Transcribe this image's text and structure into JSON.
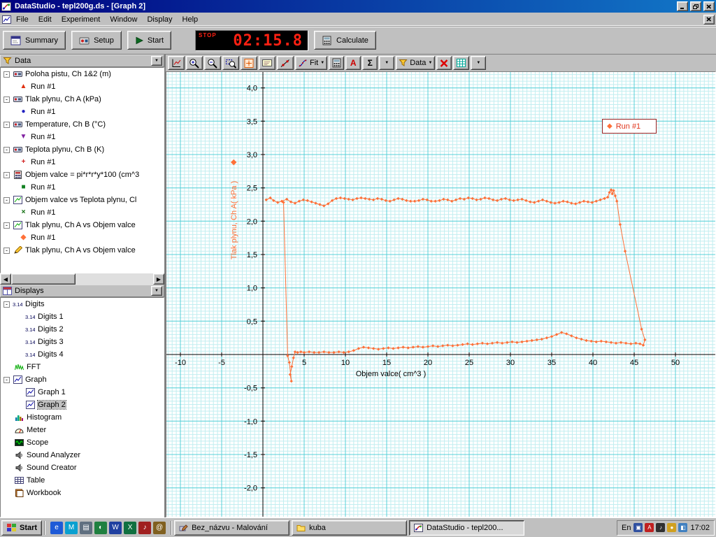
{
  "window": {
    "title": "DataStudio - tepl200g.ds - [Graph 2]",
    "menus": [
      "File",
      "Edit",
      "Experiment",
      "Window",
      "Display",
      "Help"
    ]
  },
  "toolbar": {
    "summary_label": "Summary",
    "setup_label": "Setup",
    "start_label": "Start",
    "timer_mode": "STOP",
    "timer_value": "02:15.8",
    "calculate_label": "Calculate"
  },
  "graph_toolbar": {
    "fit_label": "Fit",
    "text_tool_label": "A",
    "sigma_label": "Σ",
    "data_label": "Data"
  },
  "data_panel": {
    "title": "Data",
    "items": [
      {
        "label": "Poloha pistu, Ch 1&2 (m)",
        "icon": "sensor-icon",
        "runs": [
          {
            "label": "Run #1",
            "shape": "triangle-up",
            "color": "#e03010"
          }
        ]
      },
      {
        "label": "Tlak plynu, Ch A (kPa)",
        "icon": "sensor-icon",
        "runs": [
          {
            "label": "Run #1",
            "shape": "circle",
            "color": "#2020c0"
          }
        ]
      },
      {
        "label": "Temperature, Ch B (°C)",
        "icon": "sensor-icon",
        "runs": [
          {
            "label": "Run #1",
            "shape": "triangle-down",
            "color": "#8020a0"
          }
        ]
      },
      {
        "label": "Teplota plynu, Ch B (K)",
        "icon": "sensor-icon",
        "runs": [
          {
            "label": "Run #1",
            "shape": "plus",
            "color": "#d02020"
          }
        ]
      },
      {
        "label": "Objem valce = pi*r*r*y*100 (cm^3",
        "icon": "calculator-icon",
        "runs": [
          {
            "label": "Run #1",
            "shape": "square",
            "color": "#108020"
          }
        ]
      },
      {
        "label": "Objem valce vs Teplota plynu, Cl",
        "icon": "xy-icon",
        "runs": [
          {
            "label": "Run #1",
            "shape": "cross",
            "color": "#0a6a0a"
          }
        ]
      },
      {
        "label": "Tlak plynu, Ch A vs Objem valce",
        "icon": "xy-icon",
        "runs": [
          {
            "label": "Run #1",
            "shape": "diamond",
            "color": "#ff7038"
          }
        ]
      },
      {
        "label": "Tlak plynu, Ch A vs Objem valce",
        "icon": "pencil-icon",
        "runs": []
      }
    ]
  },
  "displays_panel": {
    "title": "Displays",
    "items": [
      {
        "label": "Digits",
        "icon": "digits-icon",
        "level": 0,
        "expand": true
      },
      {
        "label": "Digits 1",
        "icon": "digits-icon",
        "level": 1
      },
      {
        "label": "Digits 2",
        "icon": "digits-icon",
        "level": 1
      },
      {
        "label": "Digits 3",
        "icon": "digits-icon",
        "level": 1
      },
      {
        "label": "Digits 4",
        "icon": "digits-icon",
        "level": 1
      },
      {
        "label": "FFT",
        "icon": "fft-icon",
        "level": 0
      },
      {
        "label": "Graph",
        "icon": "graph-icon",
        "level": 0,
        "expand": true
      },
      {
        "label": "Graph 1",
        "icon": "graph-icon",
        "level": 1
      },
      {
        "label": "Graph 2",
        "icon": "graph-icon",
        "level": 1,
        "selected": true
      },
      {
        "label": "Histogram",
        "icon": "histogram-icon",
        "level": 0
      },
      {
        "label": "Meter",
        "icon": "meter-icon",
        "level": 0
      },
      {
        "label": "Scope",
        "icon": "scope-icon",
        "level": 0
      },
      {
        "label": "Sound Analyzer",
        "icon": "speaker-icon",
        "level": 0
      },
      {
        "label": "Sound Creator",
        "icon": "speaker-icon",
        "level": 0
      },
      {
        "label": "Table",
        "icon": "table-icon",
        "level": 0
      },
      {
        "label": "Workbook",
        "icon": "workbook-icon",
        "level": 0
      }
    ]
  },
  "graph": {
    "x_title": "Objem valce( cm^3 )",
    "y_title": "Tlak plynu, Ch A( kPa )",
    "legend_label": "Run #1",
    "x_ticks": [
      {
        "v": -10,
        "t": "-10"
      },
      {
        "v": -5,
        "t": "-5"
      },
      {
        "v": 5,
        "t": "5"
      },
      {
        "v": 10,
        "t": "10"
      },
      {
        "v": 15,
        "t": "15"
      },
      {
        "v": 20,
        "t": "20"
      },
      {
        "v": 25,
        "t": "25"
      },
      {
        "v": 30,
        "t": "30"
      },
      {
        "v": 35,
        "t": "35"
      },
      {
        "v": 40,
        "t": "40"
      },
      {
        "v": 45,
        "t": "45"
      },
      {
        "v": 50,
        "t": "50"
      }
    ],
    "y_ticks": [
      {
        "v": 4,
        "t": "4,0"
      },
      {
        "v": 3.5,
        "t": "3,5"
      },
      {
        "v": 3,
        "t": "3,0"
      },
      {
        "v": 2.5,
        "t": "2,5"
      },
      {
        "v": 2,
        "t": "2,0"
      },
      {
        "v": 1.5,
        "t": "1,5"
      },
      {
        "v": 1,
        "t": "1,0"
      },
      {
        "v": 0.5,
        "t": "0,5"
      },
      {
        "v": -0.5,
        "t": "-0,5"
      },
      {
        "v": -1,
        "t": "-1,0"
      },
      {
        "v": -1.5,
        "t": "-1,5"
      },
      {
        "v": -2,
        "t": "-2,0"
      }
    ]
  },
  "chart_data": {
    "type": "scatter",
    "title": "",
    "xlabel": "Objem valce( cm^3 )",
    "ylabel": "Tlak plynu, Ch A( kPa )",
    "xlim": [
      -11.7,
      54.9
    ],
    "ylim": [
      -2.43,
      4.24
    ],
    "x_ticks": [
      -10,
      -5,
      5,
      10,
      15,
      20,
      25,
      30,
      35,
      40,
      45,
      50
    ],
    "y_ticks": [
      4,
      3.5,
      3,
      2.5,
      2,
      1.5,
      1,
      0.5,
      -0.5,
      -1,
      -1.5,
      -2
    ],
    "x_major_step": 5,
    "x_minor_step": 0.5,
    "y_major_step": 0.5,
    "y_minor_step": 0.05,
    "grid": true,
    "legend_position": "top-right",
    "series": [
      {
        "name": "Run #1",
        "marker": "diamond",
        "color": "#ff7038",
        "points": [
          [
            0.4,
            2.32
          ],
          [
            0.9,
            2.35
          ],
          [
            1.3,
            2.31
          ],
          [
            1.8,
            2.28
          ],
          [
            2.3,
            2.3
          ],
          [
            2.9,
            2.33
          ],
          [
            3.4,
            2.29
          ],
          [
            3.9,
            2.27
          ],
          [
            4.4,
            2.3
          ],
          [
            4.9,
            2.32
          ],
          [
            5.4,
            2.31
          ],
          [
            5.9,
            2.29
          ],
          [
            6.4,
            2.27
          ],
          [
            6.9,
            2.25
          ],
          [
            7.4,
            2.23
          ],
          [
            7.9,
            2.26
          ],
          [
            8.4,
            2.31
          ],
          [
            8.9,
            2.34
          ],
          [
            9.4,
            2.35
          ],
          [
            9.9,
            2.34
          ],
          [
            10.4,
            2.33
          ],
          [
            10.9,
            2.32
          ],
          [
            11.4,
            2.34
          ],
          [
            11.9,
            2.35
          ],
          [
            12.4,
            2.34
          ],
          [
            12.9,
            2.33
          ],
          [
            13.4,
            2.32
          ],
          [
            13.9,
            2.34
          ],
          [
            14.4,
            2.33
          ],
          [
            14.9,
            2.31
          ],
          [
            15.4,
            2.3
          ],
          [
            15.9,
            2.32
          ],
          [
            16.4,
            2.34
          ],
          [
            16.9,
            2.33
          ],
          [
            17.4,
            2.31
          ],
          [
            17.9,
            2.3
          ],
          [
            18.4,
            2.3
          ],
          [
            18.9,
            2.31
          ],
          [
            19.4,
            2.33
          ],
          [
            19.9,
            2.32
          ],
          [
            20.4,
            2.3
          ],
          [
            20.9,
            2.3
          ],
          [
            21.4,
            2.31
          ],
          [
            21.9,
            2.33
          ],
          [
            22.4,
            2.32
          ],
          [
            22.9,
            2.3
          ],
          [
            23.4,
            2.32
          ],
          [
            23.9,
            2.34
          ],
          [
            24.4,
            2.33
          ],
          [
            24.9,
            2.35
          ],
          [
            25.4,
            2.34
          ],
          [
            25.9,
            2.32
          ],
          [
            26.4,
            2.33
          ],
          [
            26.9,
            2.35
          ],
          [
            27.4,
            2.34
          ],
          [
            27.9,
            2.32
          ],
          [
            28.4,
            2.31
          ],
          [
            28.9,
            2.33
          ],
          [
            29.4,
            2.34
          ],
          [
            29.9,
            2.32
          ],
          [
            30.4,
            2.31
          ],
          [
            30.9,
            2.32
          ],
          [
            31.4,
            2.33
          ],
          [
            31.9,
            2.31
          ],
          [
            32.4,
            2.29
          ],
          [
            32.9,
            2.28
          ],
          [
            33.4,
            2.3
          ],
          [
            33.9,
            2.32
          ],
          [
            34.4,
            2.3
          ],
          [
            34.9,
            2.28
          ],
          [
            35.4,
            2.27
          ],
          [
            35.9,
            2.28
          ],
          [
            36.4,
            2.3
          ],
          [
            36.9,
            2.29
          ],
          [
            37.4,
            2.27
          ],
          [
            37.9,
            2.26
          ],
          [
            38.4,
            2.28
          ],
          [
            38.9,
            2.3
          ],
          [
            39.4,
            2.29
          ],
          [
            39.9,
            2.28
          ],
          [
            40.4,
            2.3
          ],
          [
            40.9,
            2.32
          ],
          [
            41.4,
            2.34
          ],
          [
            41.8,
            2.36
          ],
          [
            42.0,
            2.43
          ],
          [
            42.2,
            2.47
          ],
          [
            42.35,
            2.41
          ],
          [
            42.5,
            2.46
          ],
          [
            42.7,
            2.38
          ],
          [
            42.9,
            2.3
          ],
          [
            43.3,
            1.95
          ],
          [
            43.9,
            1.55
          ],
          [
            45.9,
            0.38
          ],
          [
            46.3,
            0.22
          ],
          [
            46.1,
            0.14
          ],
          [
            45.7,
            0.16
          ],
          [
            45.2,
            0.17
          ],
          [
            44.6,
            0.16
          ],
          [
            44.0,
            0.17
          ],
          [
            43.4,
            0.18
          ],
          [
            42.8,
            0.17
          ],
          [
            42.2,
            0.18
          ],
          [
            41.6,
            0.19
          ],
          [
            41.0,
            0.2
          ],
          [
            40.4,
            0.19
          ],
          [
            39.8,
            0.2
          ],
          [
            39.2,
            0.21
          ],
          [
            38.6,
            0.23
          ],
          [
            38.0,
            0.25
          ],
          [
            37.4,
            0.28
          ],
          [
            36.8,
            0.31
          ],
          [
            36.2,
            0.33
          ],
          [
            35.6,
            0.3
          ],
          [
            35.0,
            0.27
          ],
          [
            34.4,
            0.25
          ],
          [
            33.8,
            0.23
          ],
          [
            33.2,
            0.22
          ],
          [
            32.6,
            0.21
          ],
          [
            32.0,
            0.2
          ],
          [
            31.4,
            0.19
          ],
          [
            30.8,
            0.18
          ],
          [
            30.2,
            0.19
          ],
          [
            29.6,
            0.18
          ],
          [
            29.0,
            0.17
          ],
          [
            28.4,
            0.18
          ],
          [
            27.8,
            0.17
          ],
          [
            27.2,
            0.16
          ],
          [
            26.6,
            0.17
          ],
          [
            26.0,
            0.16
          ],
          [
            25.4,
            0.15
          ],
          [
            24.8,
            0.16
          ],
          [
            24.2,
            0.15
          ],
          [
            23.6,
            0.14
          ],
          [
            23.0,
            0.13
          ],
          [
            22.4,
            0.14
          ],
          [
            21.8,
            0.13
          ],
          [
            21.2,
            0.12
          ],
          [
            20.6,
            0.13
          ],
          [
            20.0,
            0.12
          ],
          [
            19.4,
            0.11
          ],
          [
            18.8,
            0.12
          ],
          [
            18.2,
            0.11
          ],
          [
            17.6,
            0.1
          ],
          [
            17.0,
            0.11
          ],
          [
            16.4,
            0.1
          ],
          [
            15.8,
            0.09
          ],
          [
            15.2,
            0.1
          ],
          [
            14.6,
            0.09
          ],
          [
            14.0,
            0.08
          ],
          [
            13.4,
            0.09
          ],
          [
            12.8,
            0.1
          ],
          [
            12.2,
            0.11
          ],
          [
            11.6,
            0.09
          ],
          [
            11.0,
            0.06
          ],
          [
            10.4,
            0.04
          ],
          [
            9.8,
            0.03
          ],
          [
            9.2,
            0.04
          ],
          [
            8.6,
            0.03
          ],
          [
            8.0,
            0.03
          ],
          [
            7.4,
            0.04
          ],
          [
            6.8,
            0.03
          ],
          [
            6.2,
            0.03
          ],
          [
            5.6,
            0.04
          ],
          [
            5.0,
            0.03
          ],
          [
            4.6,
            0.04
          ],
          [
            4.2,
            0.03
          ],
          [
            3.9,
            0.04
          ],
          [
            3.7,
            -0.05
          ],
          [
            3.5,
            -0.18
          ],
          [
            3.3,
            -0.3
          ],
          [
            3.45,
            -0.4
          ],
          [
            3.2,
            -0.12
          ],
          [
            3.0,
            -0.02
          ],
          [
            2.5,
            2.28
          ]
        ]
      }
    ]
  },
  "colors": {
    "series_orange": "#ff7038",
    "grid_minor": "#c2eef0",
    "grid_major": "#58d0d8",
    "titlebar_left": "#000080",
    "titlebar_right": "#1278c8",
    "legend_text": "#e0351c"
  },
  "taskbar": {
    "start_label": "Start",
    "quicklaunch": [
      {
        "name": "quick-launch-icon-1",
        "glyph": "e",
        "color": "#1e5ad7"
      },
      {
        "name": "quick-launch-icon-2",
        "glyph": "M",
        "color": "#0aa0d0"
      },
      {
        "name": "quick-launch-icon-3",
        "glyph": "▤",
        "color": "#607080"
      },
      {
        "name": "quick-launch-icon-4",
        "glyph": "◐",
        "color": "#208040"
      },
      {
        "name": "quick-launch-icon-5",
        "glyph": "W",
        "color": "#2040a0"
      },
      {
        "name": "quick-launch-icon-6",
        "glyph": "X",
        "color": "#107040"
      },
      {
        "name": "quick-launch-icon-7",
        "glyph": "♪",
        "color": "#a02020"
      },
      {
        "name": "quick-launch-icon-8",
        "glyph": "@",
        "color": "#806020"
      }
    ],
    "tasks": [
      {
        "label": "Bez_názvu - Malování",
        "icon": "paint-icon",
        "active": false
      },
      {
        "label": "kuba",
        "icon": "folder-icon",
        "active": false
      },
      {
        "label": "DataStudio - tepl200...",
        "icon": "datastudio-icon",
        "active": true
      }
    ],
    "tray": {
      "locale": "En",
      "icons": [
        {
          "name": "tray-icon-1",
          "glyph": "▣",
          "color": "#3050a0"
        },
        {
          "name": "tray-icon-2",
          "glyph": "A",
          "color": "#c02020"
        },
        {
          "name": "tray-icon-3",
          "glyph": "♪",
          "color": "#303030"
        },
        {
          "name": "tray-icon-4",
          "glyph": "●",
          "color": "#d0a020"
        },
        {
          "name": "tray-icon-5",
          "glyph": "◧",
          "color": "#4080c0"
        }
      ],
      "clock": "17:02"
    }
  }
}
